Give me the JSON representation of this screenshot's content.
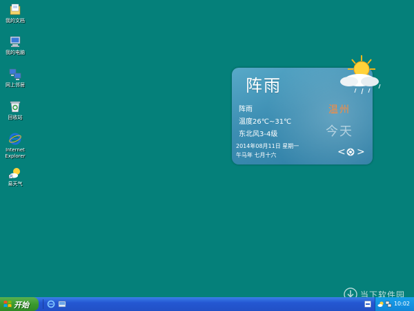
{
  "desktop": {
    "background_color": "#05807a",
    "icons": [
      {
        "label": "我的文档",
        "icon": "my-documents-icon"
      },
      {
        "label": "我的电脑",
        "icon": "my-computer-icon"
      },
      {
        "label": "网上邻居",
        "icon": "network-places-icon"
      },
      {
        "label": "回收站",
        "icon": "recycle-bin-icon"
      },
      {
        "label": "Internet\nExplorer",
        "icon": "internet-explorer-icon"
      },
      {
        "label": "易天气",
        "icon": "weather-app-icon"
      }
    ]
  },
  "weather_widget": {
    "condition_title": "阵雨",
    "condition": "阵雨",
    "temperature": "温度26℃~31℃",
    "wind": "东北风3-4级",
    "city": "温州",
    "day": "今天",
    "date": "2014年08月11日  星期一",
    "lunar_date": "午马年 七月十六",
    "prev_label": "<",
    "next_label": ">",
    "icon": "sun-cloud-rain-icon"
  },
  "taskbar": {
    "start_label": "开始",
    "quick_launch": [
      "internet-explorer-icon",
      "show-desktop-icon"
    ],
    "tray_icons": [
      "weather-tray-icon",
      "network-tray-icon"
    ],
    "clock": "10:02"
  },
  "watermark": {
    "text": "当下软件园"
  }
}
